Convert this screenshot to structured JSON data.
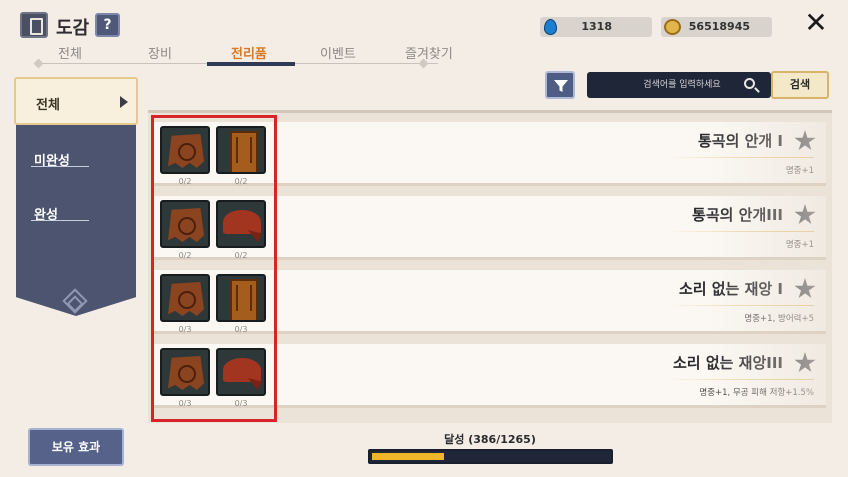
{
  "header": {
    "title": "도감",
    "help_label": "?",
    "close_label": "✕",
    "currencies": [
      {
        "icon": "water-drop-icon",
        "value": "1318"
      },
      {
        "icon": "gold-coin-icon",
        "value": "56518945"
      }
    ]
  },
  "tabs": [
    {
      "label": "전체",
      "active": false
    },
    {
      "label": "장비",
      "active": false
    },
    {
      "label": "전리품",
      "active": true
    },
    {
      "label": "이벤트",
      "active": false
    },
    {
      "label": "즐겨찾기",
      "active": false
    }
  ],
  "sidebar": {
    "items": [
      {
        "label": "전체",
        "active": true
      },
      {
        "label": "미완성",
        "active": false
      },
      {
        "label": "완성",
        "active": false
      }
    ]
  },
  "search": {
    "placeholder": "검색어를 입력하세요",
    "button_label": "검색"
  },
  "collections": [
    {
      "name": "통곡의 안개 I",
      "effect": "명중+1",
      "items": [
        {
          "icon": "cloak-icon",
          "count": "0/2"
        },
        {
          "icon": "token-icon",
          "count": "0/2"
        }
      ]
    },
    {
      "name": "통곡의 안개III",
      "effect": "명중+1",
      "items": [
        {
          "icon": "cloak-icon",
          "count": "0/2"
        },
        {
          "icon": "bandana-icon",
          "count": "0/2"
        }
      ]
    },
    {
      "name": "소리 없는 재앙 I",
      "effect": "명중+1, 방어력+5",
      "items": [
        {
          "icon": "cloak-icon",
          "count": "0/3"
        },
        {
          "icon": "token-icon",
          "count": "0/3"
        }
      ]
    },
    {
      "name": "소리 없는 재앙III",
      "effect": "명중+1, 무공 피해 저항+1.5%",
      "items": [
        {
          "icon": "cloak-icon",
          "count": "0/3"
        },
        {
          "icon": "bandana-icon",
          "count": "0/3"
        }
      ]
    }
  ],
  "footer": {
    "hold_effect_label": "보유 효과",
    "progress_label": "달성 (386/1265)",
    "progress_fraction": 0.305
  },
  "colors": {
    "accent_tab": "#d87a22",
    "highlight_box": "#d8232a",
    "progress_fill": "#efb62a"
  }
}
